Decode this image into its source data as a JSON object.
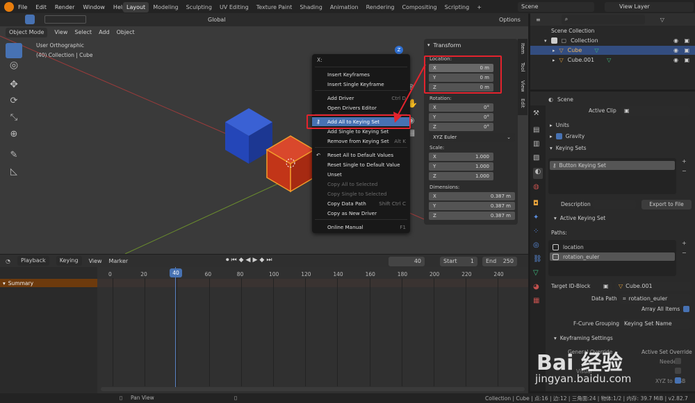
{
  "topbar": {
    "menus": [
      "File",
      "Edit",
      "Render",
      "Window",
      "Help"
    ],
    "workspaces": [
      "Layout",
      "Modeling",
      "Sculpting",
      "UV Editing",
      "Texture Paint",
      "Shading",
      "Animation",
      "Rendering",
      "Compositing",
      "Scripting"
    ],
    "active_workspace": "Layout",
    "scene": "Scene",
    "view_layer": "View Layer"
  },
  "viewport_header": {
    "mode": "Object Mode",
    "menus": [
      "View",
      "Select",
      "Add",
      "Object"
    ],
    "orientation": "Global",
    "options": "Options"
  },
  "viewport": {
    "view_name": "User Orthographic",
    "collection_info": "(40) Collection | Cube"
  },
  "npanel": {
    "title": "Transform",
    "location_label": "Location:",
    "rotation_label": "Rotation:",
    "scale_label": "Scale:",
    "dimensions_label": "Dimensions:",
    "location": [
      {
        "axis": "X",
        "value": "0 m"
      },
      {
        "axis": "Y",
        "value": "0 m"
      },
      {
        "axis": "Z",
        "value": "0 m"
      }
    ],
    "rotation": [
      {
        "axis": "X",
        "value": "0°"
      },
      {
        "axis": "Y",
        "value": "0°"
      },
      {
        "axis": "Z",
        "value": "0°"
      }
    ],
    "rotation_mode": "XYZ Euler",
    "scale": [
      {
        "axis": "X",
        "value": "1.000"
      },
      {
        "axis": "Y",
        "value": "1.000"
      },
      {
        "axis": "Z",
        "value": "1.000"
      }
    ],
    "dimensions": [
      {
        "axis": "X",
        "value": "0.387 m"
      },
      {
        "axis": "Y",
        "value": "0.387 m"
      },
      {
        "axis": "Z",
        "value": "0.387 m"
      }
    ],
    "tabs": [
      "Item",
      "Tool",
      "View",
      "Edit"
    ]
  },
  "context_menu": {
    "title": "X:",
    "items": {
      "insert_keyframes": "Insert Keyframes",
      "insert_single": "Insert Single Keyframe",
      "add_driver": "Add Driver",
      "add_driver_sc": "Ctrl D",
      "open_drivers": "Open Drivers Editor",
      "add_all_keying": "Add All to Keying Set",
      "add_single_keying": "Add Single to Keying Set",
      "remove_keying": "Remove from Keying Set",
      "remove_keying_sc": "Alt K",
      "reset_all": "Reset All to Default Values",
      "reset_single": "Reset Single to Default Value",
      "unset": "Unset",
      "copy_all_sel": "Copy All to Selected",
      "copy_single_sel": "Copy Single to Selected",
      "copy_data_path": "Copy Data Path",
      "copy_data_path_sc": "Shift Ctrl C",
      "copy_new_driver": "Copy as New Driver",
      "online_manual": "Online Manual",
      "online_manual_sc": "F1"
    }
  },
  "timeline": {
    "menus": [
      "Playback",
      "Keying",
      "View",
      "Marker"
    ],
    "current_frame": "40",
    "start_label": "Start",
    "start": "1",
    "end_label": "End",
    "end": "250",
    "ticks": [
      "0",
      "20",
      "40",
      "60",
      "80",
      "100",
      "120",
      "140",
      "160",
      "180",
      "200",
      "220",
      "240"
    ],
    "summary": "Summary"
  },
  "outliner": {
    "root": "Scene Collection",
    "collection": "Collection",
    "items": [
      "Cube",
      "Cube.001"
    ]
  },
  "properties": {
    "scene": "Scene",
    "active_clip": "Active Clip",
    "units": "Units",
    "gravity": "Gravity",
    "keying_sets": "Keying Sets",
    "keying_set_item": "Button Keying Set",
    "description_label": "Description",
    "export_button": "Export to File",
    "active_keying_set": "Active Keying Set",
    "paths_label": "Paths:",
    "paths": [
      "location",
      "rotation_euler"
    ],
    "target_id_label": "Target ID-Block",
    "target_id": "Cube.001",
    "data_path_label": "Data Path",
    "data_path": "rotation_euler",
    "array_all": "Array All Items",
    "fcurve_grouping_label": "F-Curve Grouping",
    "fcurve_grouping": "Keying Set Name",
    "keyframing_settings": "Keyframing Settings",
    "general_override": "General Override",
    "active_set_override": "Active Set Override",
    "needed": "Needed",
    "visual": "Visual",
    "xyz_rgb": "XYZ to RGB"
  },
  "statusbar": {
    "pan": "Pan View",
    "info": "Collection | Cube | 点:16 | 边:12 | 三角面:24 | 物体:1/2 | 内存: 39.7 MiB | v2.82.7"
  },
  "watermark": {
    "text": "Bai 经验",
    "url": "jingyan.baidu.com"
  },
  "colors": {
    "accent": "#4772b3",
    "red_annotation": "#e4232d",
    "timeline_cursor": "#5680c2",
    "orange": "#e8a33c"
  }
}
